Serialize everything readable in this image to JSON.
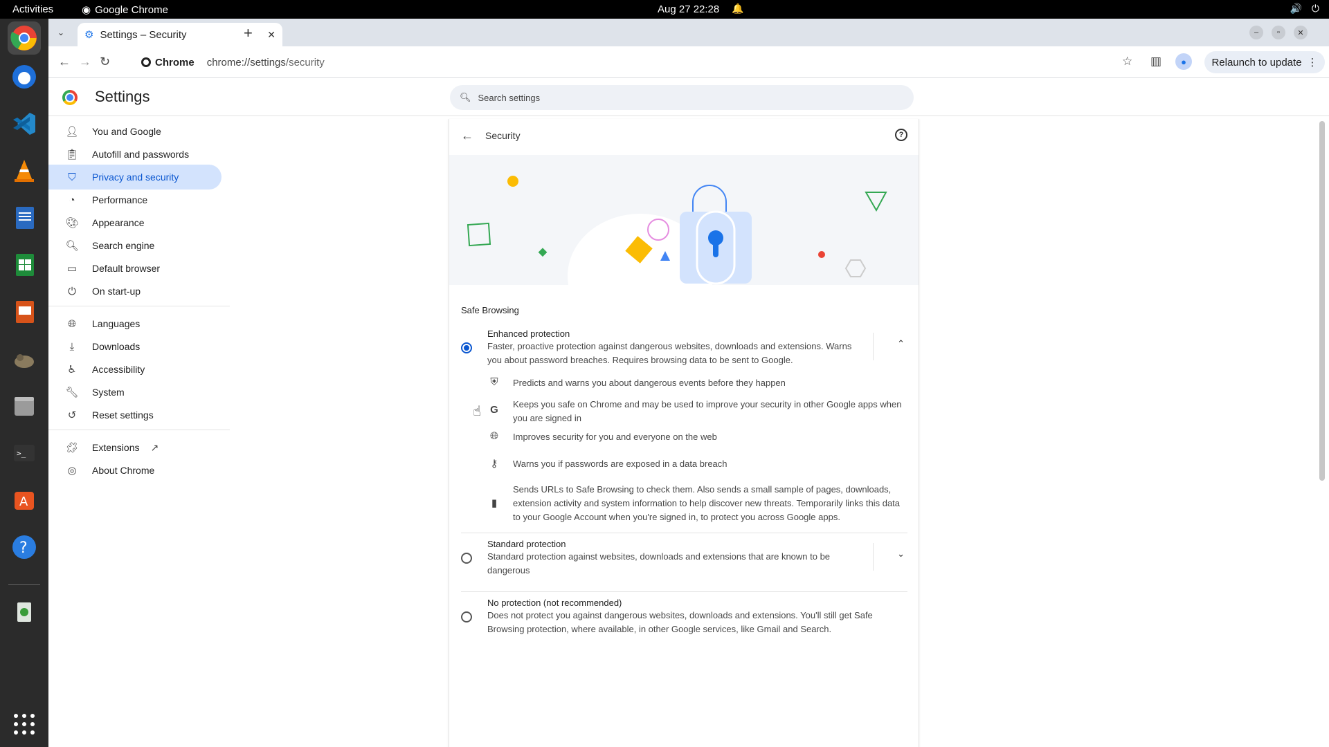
{
  "topbar": {
    "activities": "Activities",
    "app_name": "Google Chrome",
    "clock": "Aug 27  22:28"
  },
  "dock": {
    "apps": [
      "chrome-icon",
      "thunderbird-icon",
      "vscode-icon",
      "vlc-icon",
      "writer-icon",
      "calc-icon",
      "impress-icon",
      "gimp-icon",
      "files-icon",
      "terminal-icon",
      "software-icon",
      "help-icon",
      "trash-icon",
      "app-grid-icon"
    ]
  },
  "tab": {
    "title": "Settings – Security"
  },
  "omnibox": {
    "chip": "Chrome",
    "url_host": "chrome://settings",
    "url_path": "/security"
  },
  "toolbar": {
    "relaunch_label": "Relaunch to update"
  },
  "settings": {
    "title": "Settings",
    "search_placeholder": "Search settings"
  },
  "nav": {
    "items": [
      {
        "label": "You and Google",
        "icon": "person-icon"
      },
      {
        "label": "Autofill and passwords",
        "icon": "clipboard-icon"
      },
      {
        "label": "Privacy and security",
        "icon": "shield-icon"
      },
      {
        "label": "Performance",
        "icon": "gauge-icon"
      },
      {
        "label": "Appearance",
        "icon": "palette-icon"
      },
      {
        "label": "Search engine",
        "icon": "search-icon"
      },
      {
        "label": "Default browser",
        "icon": "browser-icon"
      },
      {
        "label": "On start-up",
        "icon": "power-icon"
      },
      {
        "label": "Languages",
        "icon": "globe-icon"
      },
      {
        "label": "Downloads",
        "icon": "download-icon"
      },
      {
        "label": "Accessibility",
        "icon": "accessibility-icon"
      },
      {
        "label": "System",
        "icon": "wrench-icon"
      },
      {
        "label": "Reset settings",
        "icon": "history-icon"
      },
      {
        "label": "Extensions",
        "icon": "puzzle-icon"
      },
      {
        "label": "About Chrome",
        "icon": "chrome-icon"
      }
    ]
  },
  "page": {
    "title": "Security",
    "section_title": "Safe Browsing",
    "enhanced": {
      "title": "Enhanced protection",
      "desc": "Faster, proactive protection against dangerous websites, downloads and extensions. Warns you about password breaches. Requires browsing data to be sent to Google.",
      "selected": true,
      "features": [
        {
          "icon": "shield-icon",
          "text": "Predicts and warns you about dangerous events before they happen"
        },
        {
          "icon": "google-g-icon",
          "text": "Keeps you safe on Chrome and may be used to improve your security in other Google apps when you are signed in"
        },
        {
          "icon": "globe-icon",
          "text": "Improves security for you and everyone on the web"
        },
        {
          "icon": "key-icon",
          "text": "Warns you if passwords are exposed in a data breach"
        },
        {
          "icon": "bar-chart-icon",
          "text": "Sends URLs to Safe Browsing to check them. Also sends a small sample of pages, downloads, extension activity and system information to help discover new threats. Temporarily links this data to your Google Account when you're signed in, to protect you across Google apps."
        }
      ]
    },
    "standard": {
      "title": "Standard protection",
      "desc": "Standard protection against websites, downloads and extensions that are known to be dangerous"
    },
    "none": {
      "title": "No protection (not recommended)",
      "desc": "Does not protect you against dangerous websites, downloads and extensions. You'll still get Safe Browsing protection, where available, in other Google services, like Gmail and Search."
    }
  },
  "colors": {
    "accent": "#0b57d0",
    "nav_selected_bg": "#d3e3fd",
    "dock_bg": "#2b2b2b"
  }
}
